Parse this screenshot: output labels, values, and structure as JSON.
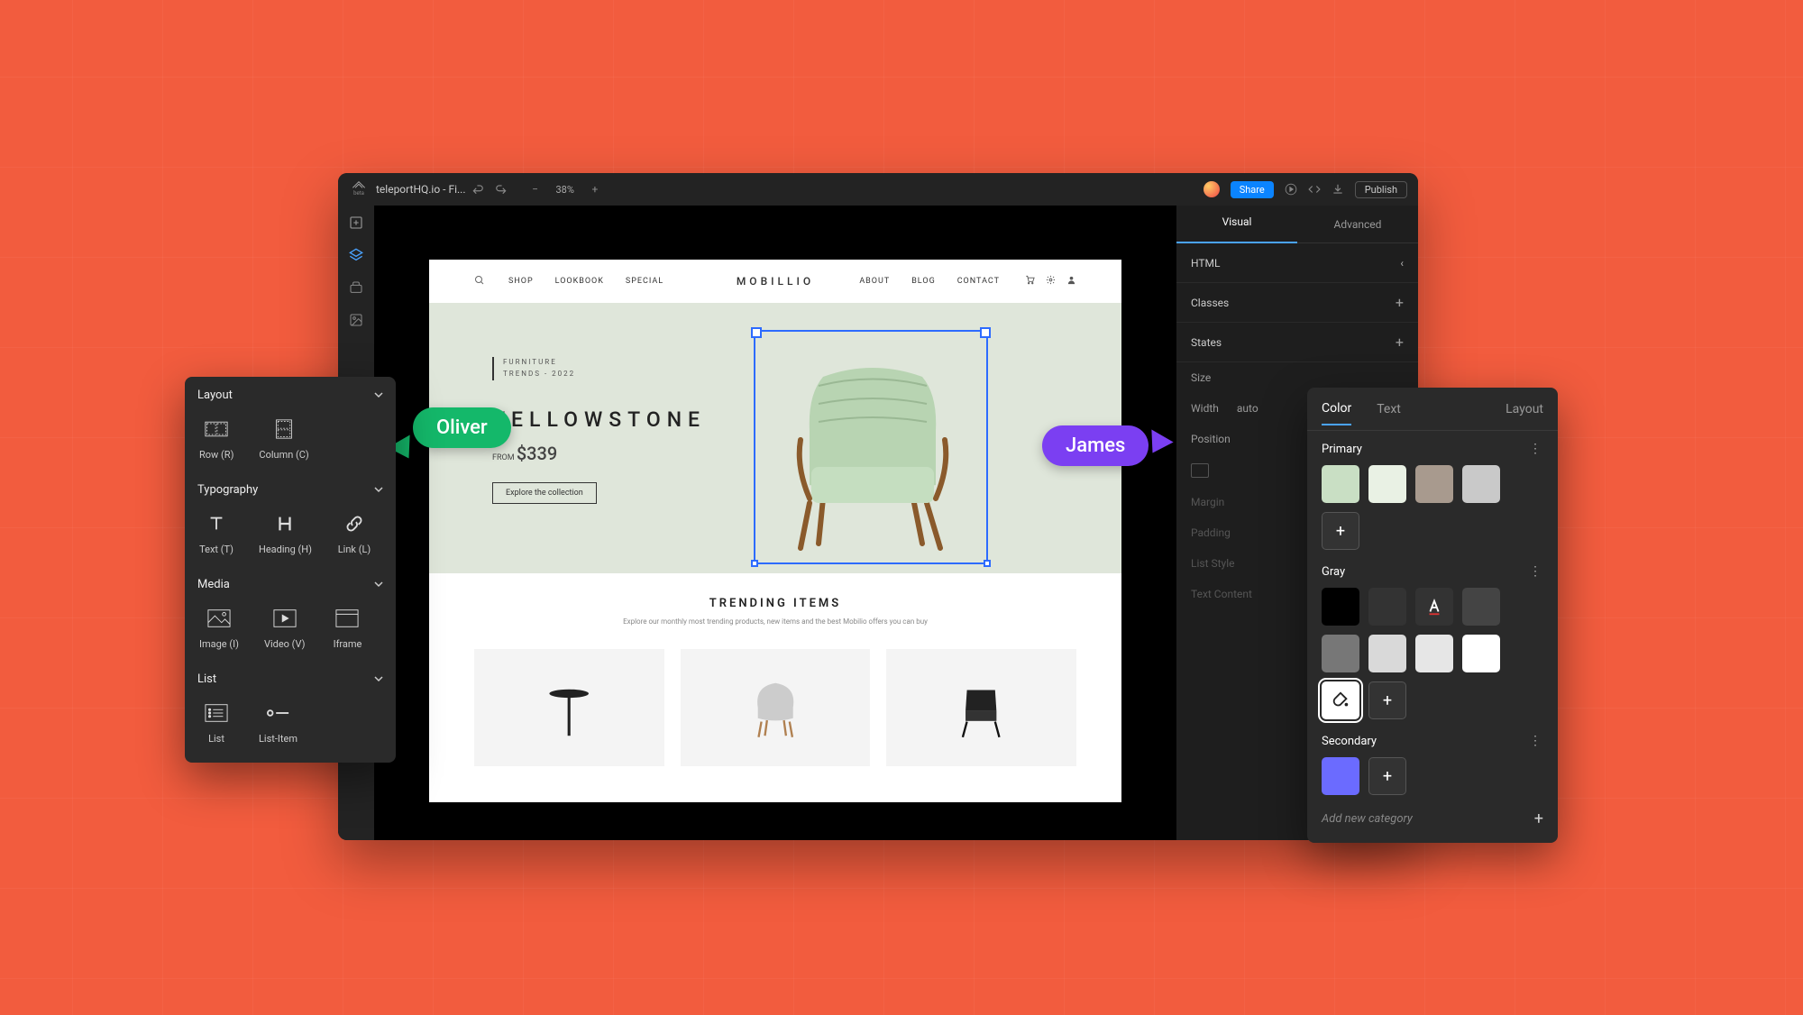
{
  "topbar": {
    "title": "teleportHQ.io - Fi...",
    "beta": "beta",
    "zoom": "38%",
    "share": "Share",
    "publish": "Publish"
  },
  "inspector": {
    "tabs": {
      "visual": "Visual",
      "advanced": "Advanced"
    },
    "html": "HTML",
    "classes": "Classes",
    "states": "States",
    "size": "Size",
    "width": "Width",
    "auto": "auto",
    "position": "Position",
    "margin": "Margin",
    "padding": "Padding",
    "list_style": "List Style",
    "text_content": "Text Content"
  },
  "canvas": {
    "nav": {
      "shop": "SHOP",
      "lookbook": "LOOKBOOK",
      "special": "SPECIAL",
      "about": "ABOUT",
      "blog": "BLOG",
      "contact": "CONTACT"
    },
    "brand": "MOBILLIO",
    "tagline1": "FURNITURE",
    "tagline2": "TRENDS - 2022",
    "hero_title": "YELLOWSTONE",
    "from": "FROM",
    "price": "$339",
    "cta": "Explore the collection",
    "trending_title": "TRENDING ITEMS",
    "trending_sub": "Explore our monthly most trending products, new items and the best Mobilio offers you can buy"
  },
  "cursors": {
    "oliver": "Oliver",
    "james": "James"
  },
  "leftpanel": {
    "layout": "Layout",
    "row": "Row (R)",
    "column": "Column (C)",
    "typography": "Typography",
    "text": "Text (T)",
    "heading": "Heading (H)",
    "link": "Link (L)",
    "media": "Media",
    "image": "Image (I)",
    "video": "Video (V)",
    "iframe": "Iframe",
    "list": "List",
    "list_item": "List",
    "listitem": "List-Item"
  },
  "colorpanel": {
    "tabs": {
      "color": "Color",
      "text": "Text",
      "layout": "Layout"
    },
    "primary": "Primary",
    "gray": "Gray",
    "secondary": "Secondary",
    "add_cat": "Add new category",
    "swatches": {
      "primary": [
        "#c9dfc4",
        "#e9f1e4",
        "#a89a8e",
        "#c9c9c9"
      ],
      "gray_row1": [
        "#000000",
        "#333333",
        "text-icon",
        "#444444",
        "#777777"
      ],
      "gray_row2": [
        "#d9d9d9",
        "#e6e6e6",
        "#ffffff",
        "fill-icon"
      ],
      "secondary": [
        "#6b6bff"
      ]
    }
  }
}
